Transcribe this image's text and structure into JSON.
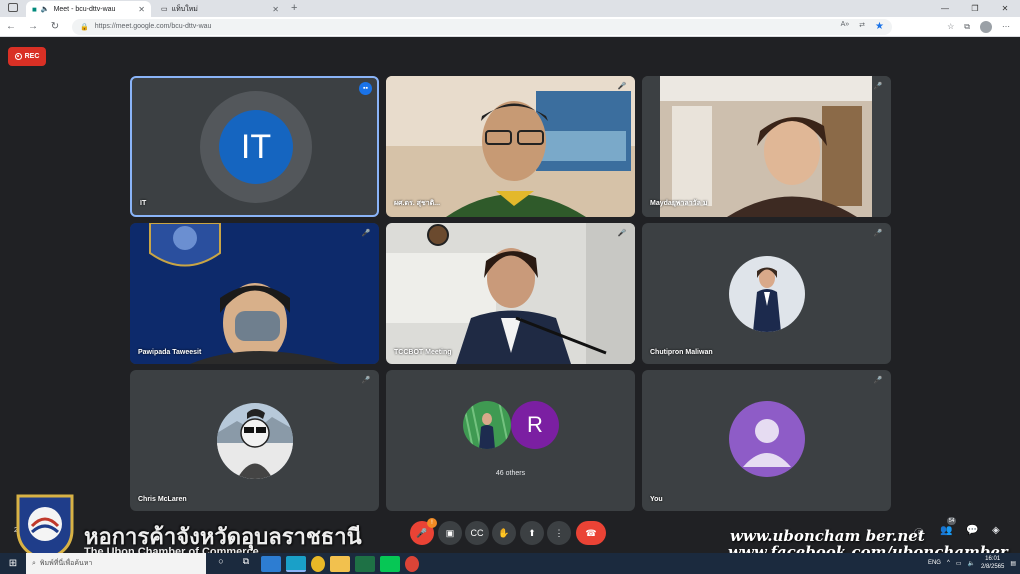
{
  "browser": {
    "tabs": [
      {
        "label": "Meet - bcu-dttv-wau",
        "active": true
      },
      {
        "label": "แท็บใหม่",
        "active": false
      }
    ],
    "new_tab": "+",
    "url": "https://meet.google.com/bcu-dttv-wau",
    "window_controls": [
      "—",
      "❐",
      "✕"
    ]
  },
  "meet": {
    "rec_label": "REC",
    "tiles": [
      {
        "name": "IT",
        "initials": "IT",
        "state": "speaking"
      },
      {
        "name": "ผศ.ดร. สุชาติ...",
        "state": "muted"
      },
      {
        "name": "Maydaยุพาลาวัล ม",
        "state": "muted"
      },
      {
        "name": "Pawipada Taweesit",
        "state": "muted"
      },
      {
        "name": "TCCBOT Meeting",
        "state": "muted"
      },
      {
        "name": "Chutipron Maliwan",
        "state": "muted"
      },
      {
        "name": "Chris McLaren",
        "state": "muted"
      },
      {
        "name": "46 others",
        "initials": "R"
      },
      {
        "name": "You",
        "state": "muted"
      }
    ],
    "meeting_time": "2:1",
    "participants_count": "54",
    "mic_badge": "!"
  },
  "watermark": {
    "org_th": "หอการค้าจังหวัดอุบลราชธานี",
    "org_en": "The Ubon Chamber of Commerce",
    "url1": "www.uboncham ber.net",
    "url2": "www.facebook.com/ubonchamber"
  },
  "taskbar": {
    "search_placeholder": "พิมพ์ที่นี่เพื่อค้นหา",
    "lang": "ENG",
    "time": "16:01",
    "date": "2/8/2565"
  },
  "colors": {
    "meet_bg": "#202124",
    "tile_bg": "#3c4043",
    "rec_red": "#d93025",
    "active_border": "#8ab4f8",
    "it_avatar": "#1565c0",
    "r_avatar": "#7b1fa2",
    "you_avatar": "#8e5cc7"
  }
}
